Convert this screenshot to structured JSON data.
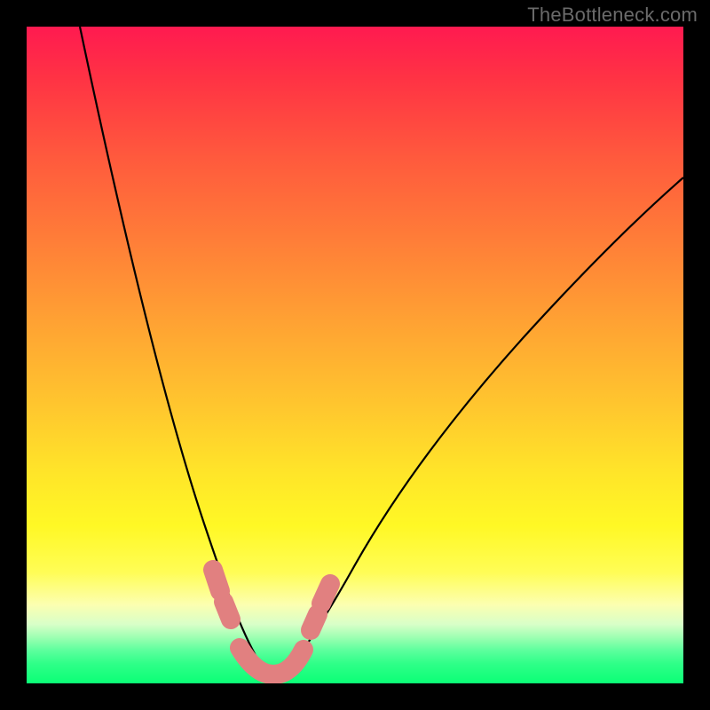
{
  "watermark": {
    "text": "TheBottleneck.com"
  },
  "colors": {
    "gradient_top": "#ff1a50",
    "gradient_bottom": "#0bff76",
    "curve_stroke": "#000000",
    "cluster_stroke": "#e18080",
    "frame_bg": "#000000"
  },
  "chart_data": {
    "type": "line",
    "title": "",
    "xlabel": "",
    "ylabel": "",
    "xlim": [
      0,
      100
    ],
    "ylim": [
      0,
      100
    ],
    "grid": false,
    "legend": {
      "position": "none"
    },
    "series": [
      {
        "name": "bottleneck-curve",
        "x": [
          8,
          10,
          12,
          14,
          16,
          18,
          20,
          22,
          24,
          26,
          28,
          30,
          31,
          32,
          33,
          34,
          35,
          36,
          38,
          40,
          42,
          44,
          48,
          54,
          60,
          68,
          78,
          90,
          100
        ],
        "y": [
          100,
          92,
          83,
          74,
          65,
          56,
          47,
          39,
          31,
          24,
          18,
          12,
          9,
          6,
          4,
          2.5,
          2,
          2,
          2,
          2.2,
          3,
          5,
          9,
          16,
          24,
          34,
          46,
          58,
          68
        ]
      }
    ],
    "markers": [
      {
        "name": "cluster-left-upper",
        "x": 29.5,
        "y": 14.5
      },
      {
        "name": "cluster-left-lower",
        "x": 30.8,
        "y": 10.5
      },
      {
        "name": "cluster-bottom-1",
        "x": 33.5,
        "y": 3.5
      },
      {
        "name": "cluster-bottom-2",
        "x": 36.0,
        "y": 2.2
      },
      {
        "name": "cluster-bottom-3",
        "x": 39.0,
        "y": 2.2
      },
      {
        "name": "cluster-bottom-4",
        "x": 41.8,
        "y": 3.5
      },
      {
        "name": "cluster-right-lower",
        "x": 44.0,
        "y": 8.5
      },
      {
        "name": "cluster-right-upper",
        "x": 45.6,
        "y": 13.0
      }
    ]
  }
}
